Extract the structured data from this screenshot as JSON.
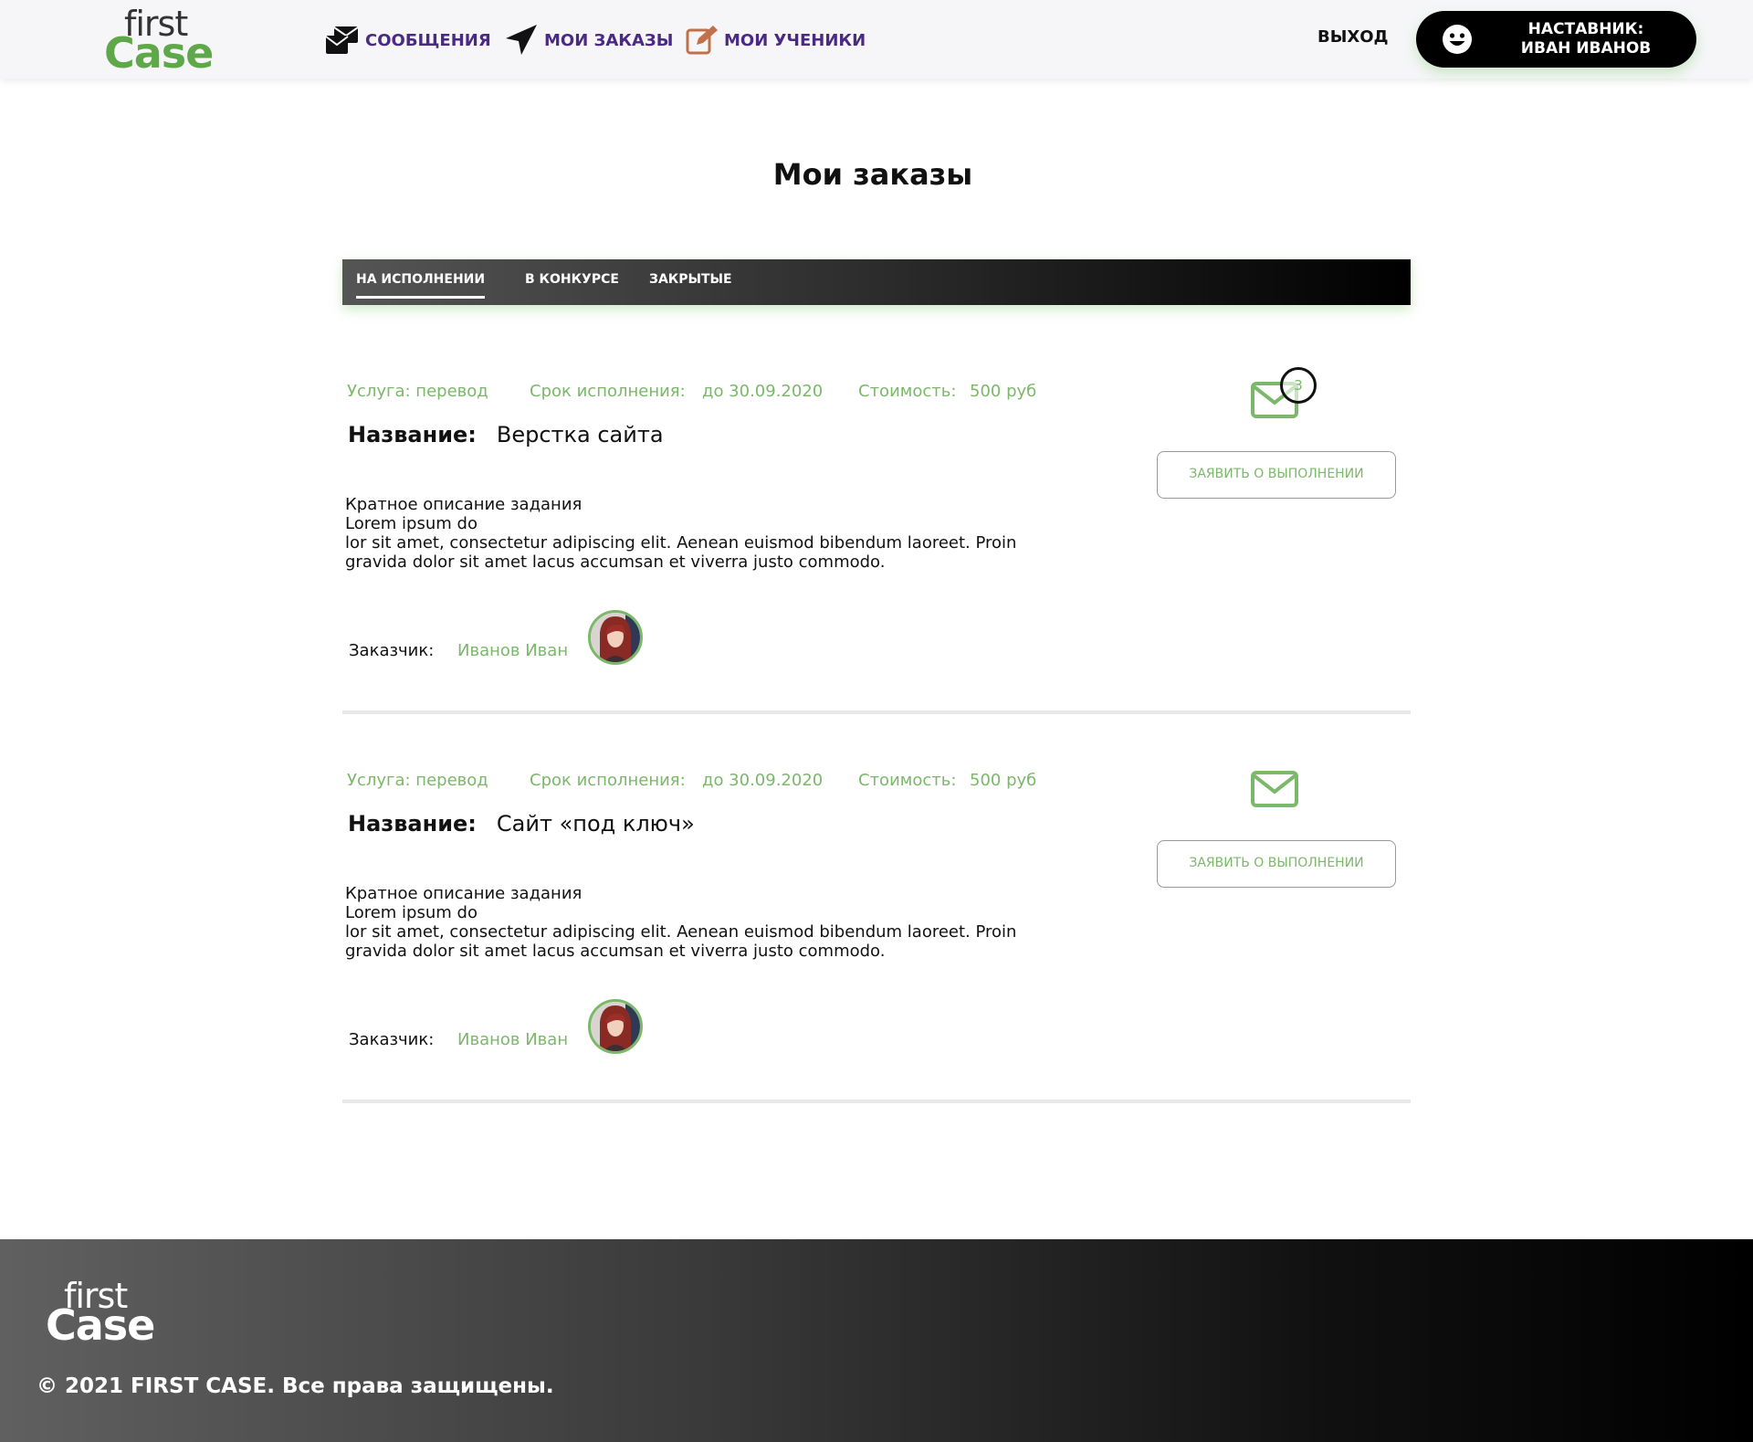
{
  "brand": {
    "logo_line1": "first",
    "logo_line2": "Case",
    "accent": "#7bb86a",
    "nav_color": "#4a2a83"
  },
  "header": {
    "nav": [
      {
        "label": "СООБЩЕНИЯ",
        "icon": "messages-icon"
      },
      {
        "label": "МОИ ЗАКАЗЫ",
        "icon": "send-icon"
      },
      {
        "label": "МОИ УЧЕНИКИ",
        "icon": "edit-icon"
      }
    ],
    "logout": "ВЫХОД",
    "user": {
      "line1": "НАСТАВНИК:",
      "line2": "ИВАН ИВАНОВ",
      "icon": "smile-icon"
    }
  },
  "page": {
    "title": "Мои заказы"
  },
  "tabs": [
    {
      "label": "НА ИСПОЛНЕНИИ",
      "active": true
    },
    {
      "label": "В КОНКУРСЕ",
      "active": false
    },
    {
      "label": "ЗАКРЫТЫЕ",
      "active": false
    }
  ],
  "orders": [
    {
      "service": "Услуга: перевод",
      "deadline_label": "Срок исполнения:",
      "deadline": "до 30.09.2020",
      "cost_label": "Стоимость:",
      "cost": "500 руб",
      "name_label": "Название:",
      "name": "Верстка сайта",
      "desc": [
        "Кратное описание задания",
        "Lorem ipsum do",
        "lor sit amet, consectetur adipiscing elit. Aenean euismod bibendum laoreet. Proin",
        "gravida dolor sit amet lacus accumsan et viverra justo commodo."
      ],
      "customer_label": "Заказчик:",
      "customer": "Иванов Иван",
      "messages_count": "3",
      "button": "ЗАЯВИТЬ О ВЫПОЛНЕНИИ"
    },
    {
      "service": "Услуга: перевод",
      "deadline_label": "Срок исполнения:",
      "deadline": "до 30.09.2020",
      "cost_label": "Стоимость:",
      "cost": "500 руб",
      "name_label": "Название:",
      "name": "Сайт «под ключ»",
      "desc": [
        "Кратное описание задания",
        "Lorem ipsum do",
        "lor sit amet, consectetur adipiscing elit. Aenean euismod bibendum laoreet. Proin",
        "gravida dolor sit amet lacus accumsan et viverra justo commodo."
      ],
      "customer_label": "Заказчик:",
      "customer": "Иванов Иван",
      "button": "ЗАЯВИТЬ О ВЫПОЛНЕНИИ"
    }
  ],
  "footer": {
    "logo_line1": "first",
    "logo_line2": "Case",
    "copyright": "© 2021 FIRST CASE. Все права защищены."
  }
}
